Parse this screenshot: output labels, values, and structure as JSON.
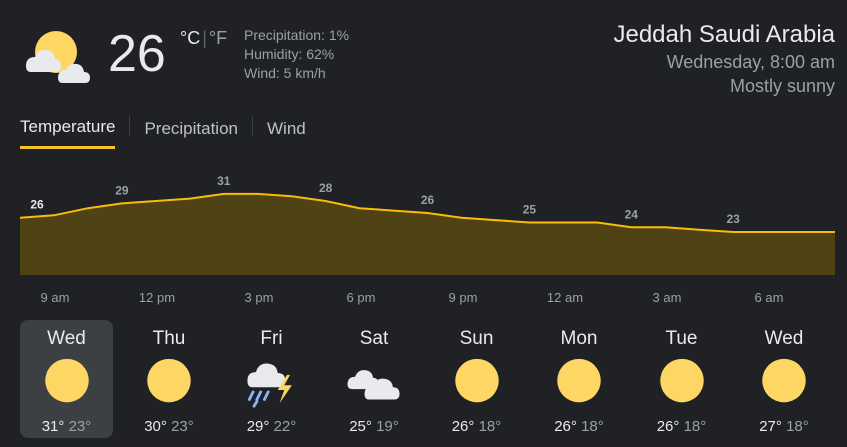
{
  "current": {
    "condition_icon": "partly-cloudy-icon",
    "temperature": "26",
    "unit_c": "°C",
    "unit_sep": "|",
    "unit_f": "°F",
    "precipitation": "Precipitation: 1%",
    "humidity": "Humidity: 62%",
    "wind": "Wind: 5 km/h"
  },
  "location": {
    "city": "Jeddah Saudi Arabia",
    "datetime": "Wednesday, 8:00 am",
    "condition": "Mostly sunny"
  },
  "tabs": [
    {
      "label": "Temperature",
      "active": true
    },
    {
      "label": "Precipitation",
      "active": false
    },
    {
      "label": "Wind",
      "active": false
    }
  ],
  "colors": {
    "background": "#202124",
    "accent": "#fbc02d",
    "chart_line": "#fbbc04",
    "chart_fill": "#4f4215",
    "sun": "#fdd663"
  },
  "chart_data": {
    "type": "area",
    "x": [
      "8 am",
      "9 am",
      "10 am",
      "11 am",
      "12 pm",
      "1 pm",
      "2 pm",
      "3 pm",
      "4 pm",
      "5 pm",
      "6 pm",
      "7 pm",
      "8 pm",
      "9 pm",
      "10 pm",
      "11 pm",
      "12 am",
      "1 am",
      "2 am",
      "3 am",
      "4 am",
      "5 am",
      "6 am",
      "7 am",
      "8 am"
    ],
    "values": [
      26,
      26.5,
      28,
      29,
      29.5,
      30,
      31,
      31,
      30.5,
      29.5,
      28,
      27.5,
      27,
      26,
      25.5,
      25,
      25,
      25,
      24,
      24,
      23.5,
      23,
      23,
      23,
      23
    ],
    "labels": [
      {
        "index": 0,
        "text": "26"
      },
      {
        "index": 3,
        "text": "29"
      },
      {
        "index": 6,
        "text": "31"
      },
      {
        "index": 9,
        "text": "28"
      },
      {
        "index": 12,
        "text": "26"
      },
      {
        "index": 15,
        "text": "25"
      },
      {
        "index": 18,
        "text": "24"
      },
      {
        "index": 21,
        "text": "23"
      }
    ],
    "ylim": [
      14,
      36
    ]
  },
  "time_axis": [
    "9 am",
    "12 pm",
    "3 pm",
    "6 pm",
    "9 pm",
    "12 am",
    "3 am",
    "6 am"
  ],
  "days": [
    {
      "name": "Wed",
      "icon": "sunny-icon",
      "high": "31°",
      "low": "23°",
      "selected": true
    },
    {
      "name": "Thu",
      "icon": "sunny-icon",
      "high": "30°",
      "low": "23°",
      "selected": false
    },
    {
      "name": "Fri",
      "icon": "thunderstorm-icon",
      "high": "29°",
      "low": "22°",
      "selected": false
    },
    {
      "name": "Sat",
      "icon": "cloudy-icon",
      "high": "25°",
      "low": "19°",
      "selected": false
    },
    {
      "name": "Sun",
      "icon": "sunny-icon",
      "high": "26°",
      "low": "18°",
      "selected": false
    },
    {
      "name": "Mon",
      "icon": "sunny-icon",
      "high": "26°",
      "low": "18°",
      "selected": false
    },
    {
      "name": "Tue",
      "icon": "sunny-icon",
      "high": "26°",
      "low": "18°",
      "selected": false
    },
    {
      "name": "Wed",
      "icon": "sunny-icon",
      "high": "27°",
      "low": "18°",
      "selected": false
    }
  ]
}
